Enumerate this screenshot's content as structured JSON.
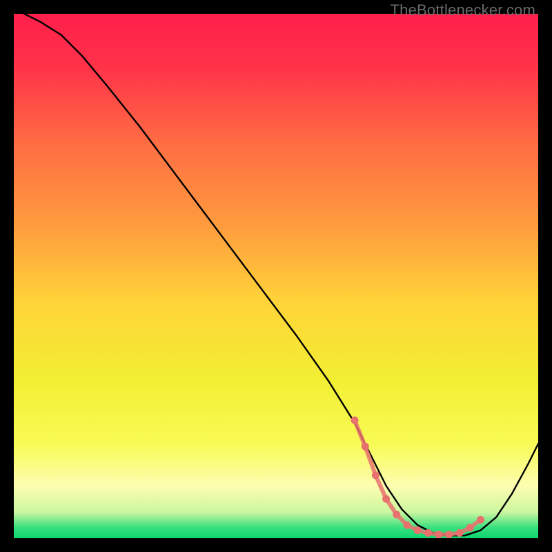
{
  "watermark": "TheBottlenecker.com",
  "gradient": {
    "stops": [
      {
        "offset": 0.0,
        "color": "#ff1f4b"
      },
      {
        "offset": 0.1,
        "color": "#ff3249"
      },
      {
        "offset": 0.25,
        "color": "#ff6e43"
      },
      {
        "offset": 0.4,
        "color": "#ff9a3e"
      },
      {
        "offset": 0.55,
        "color": "#ffd438"
      },
      {
        "offset": 0.7,
        "color": "#f2ef33"
      },
      {
        "offset": 0.82,
        "color": "#f8fb55"
      },
      {
        "offset": 0.9,
        "color": "#fdfdb0"
      },
      {
        "offset": 0.95,
        "color": "#ccf7a0"
      },
      {
        "offset": 0.98,
        "color": "#37e07e"
      },
      {
        "offset": 1.0,
        "color": "#0ed670"
      }
    ]
  },
  "chart_data": {
    "type": "line",
    "title": "",
    "xlabel": "",
    "ylabel": "",
    "xlim": [
      0,
      100
    ],
    "ylim": [
      0,
      100
    ],
    "series": [
      {
        "name": "curve",
        "x": [
          2,
          5,
          9,
          13,
          18,
          24,
          30,
          36,
          42,
          48,
          54,
          60,
          65,
          68,
          71,
          74,
          77,
          80,
          83,
          86,
          89,
          92,
          95,
          98,
          100
        ],
        "y": [
          100,
          98.5,
          96,
          92,
          86,
          78.5,
          70.5,
          62.5,
          54.5,
          46.5,
          38.5,
          30,
          22,
          16,
          10,
          5.5,
          2.5,
          1,
          0.5,
          0.5,
          1.5,
          4,
          8.5,
          14,
          18
        ]
      }
    ],
    "markers": {
      "name": "bottleneck-range",
      "color": "#e8716e",
      "x": [
        65,
        67,
        69,
        71,
        73,
        75,
        77,
        79,
        81,
        83,
        85,
        87,
        89
      ],
      "y": [
        22.5,
        17.5,
        12,
        7.5,
        4.5,
        2.5,
        1.5,
        1,
        0.7,
        0.7,
        1,
        2,
        3.5
      ]
    }
  }
}
